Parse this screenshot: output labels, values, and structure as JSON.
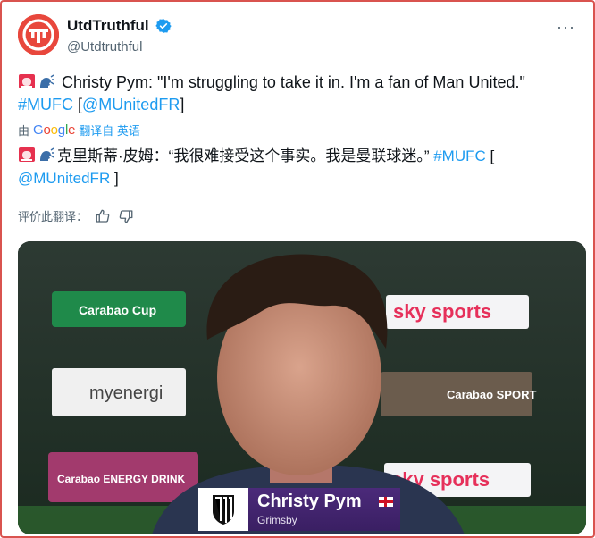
{
  "account": {
    "display_name": "UtdTruthful",
    "handle": "@Utdtruthful",
    "verified": true,
    "avatar_icon": "utd-logo-icon"
  },
  "tweet": {
    "quote_text": "Christy Pym: \"I'm struggling to take it in. I'm a fan of Man United.\"",
    "hashtag": "#MUFC",
    "mention_open": "[",
    "mention": "@MUnitedFR",
    "mention_close": "]"
  },
  "translation": {
    "prefix": "由",
    "provider": "Google",
    "action": "翻译自 英语",
    "text": "克里斯蒂·皮姆：“我很难接受这个事实。我是曼联球迷。”",
    "hashtag": "#MUFC",
    "mention": "@MUnitedFR",
    "bracket_open": "[",
    "bracket_close": "]",
    "rate_label": "评价此翻译："
  },
  "media": {
    "ads": [
      "Carabao Cup",
      "sky sports",
      "myenergi",
      "Carabao SPORT",
      "Carabao ENERGY DRINK",
      "sky sports"
    ],
    "lower_third": {
      "name": "Christy Pym",
      "club": "Grimsby"
    }
  },
  "colors": {
    "link": "#1d9bf0",
    "avatar_bg": "#e8473c",
    "lower_third_bg": "#4b2a7a"
  }
}
